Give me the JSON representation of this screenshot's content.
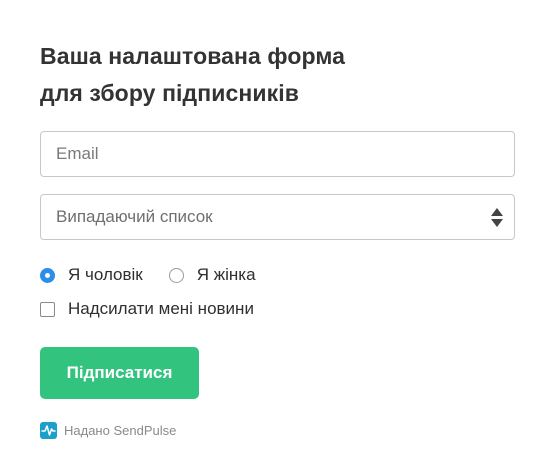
{
  "form": {
    "title_line1": "Ваша налаштована форма",
    "title_line2": "для збору підписників",
    "email_placeholder": "Email",
    "select": {
      "selected": "Випадаючий список"
    },
    "radio_options": [
      {
        "label": "Я чоловік",
        "checked": true
      },
      {
        "label": "Я жінка",
        "checked": false
      }
    ],
    "checkbox_label": "Надсилати мені новини",
    "submit_label": "Підписатися",
    "powered_by": "Надано SendPulse"
  },
  "colors": {
    "button": "#32c47f",
    "radio_checked": "#2b8fe8",
    "logo": "#1aa0c9"
  }
}
